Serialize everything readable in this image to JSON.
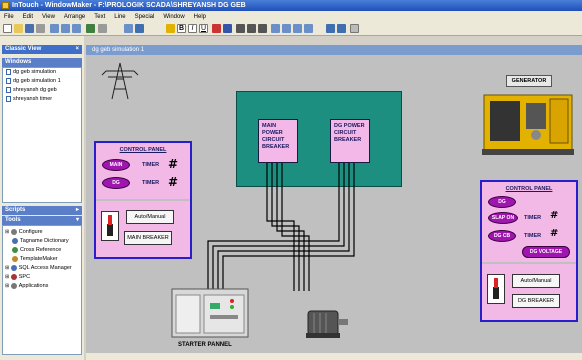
{
  "window": {
    "title": "InTouch - WindowMaker - F:\\PROLOGIK SCADA\\SHREYANSH DG GEB"
  },
  "menu": [
    "File",
    "Edit",
    "View",
    "Arrange",
    "Text",
    "Line",
    "Special",
    "Window",
    "Help"
  ],
  "sidebar": {
    "classic_view_title": "Classic View",
    "windows_title": "Windows",
    "windows_items": [
      "dg geb simulation",
      "dg geb simulation 1",
      "shreyansh dg geb",
      "shreyansh timer"
    ],
    "scripts_title": "Scripts",
    "tools_title": "Tools",
    "tools_items": [
      "Configure",
      "Tagname Dictionary",
      "Cross Reference",
      "TemplateMaker",
      "SQL Access Manager",
      "SPC",
      "Applications"
    ]
  },
  "document": {
    "tab_title": "dg geb simulation 1"
  },
  "diagram": {
    "main_breaker_label": "MAIN POWER CIRCUIT BREAKER",
    "dg_breaker_label": "DG POWER CIRCUIT BREAKER",
    "generator_label": "GENERATOR",
    "starter_label": "STARTER PANNEL",
    "left_panel": {
      "title": "CONTROL PANEL",
      "oval_main": "MAIN",
      "oval_dg": "DG",
      "timer_label_1": "TIMER",
      "timer_label_2": "TIMER",
      "timer_value_1": "#",
      "timer_value_2": "#",
      "auto_manual": "Auto/Manual",
      "breaker_button": "MAIN BREAKER"
    },
    "right_panel": {
      "title": "CONTROL PANEL",
      "oval_dg": "DG",
      "oval_slap_on": "SLAP ON",
      "oval_dg_cb": "DG CB",
      "timer_label_1": "TIMER",
      "timer_label_2": "TIMER",
      "timer_value_1": "#",
      "timer_value_2": "#",
      "dg_voltage": "DG VOLTAGE",
      "auto_manual": "Auto/Manual",
      "breaker_button": "DG BREAKER"
    }
  },
  "colors": {
    "teal": "#1c8f80",
    "pink": "#f2b8e6",
    "purple": "#a015b0",
    "panel_border": "#2a1ecc",
    "generator_yellow": "#e3b200"
  }
}
